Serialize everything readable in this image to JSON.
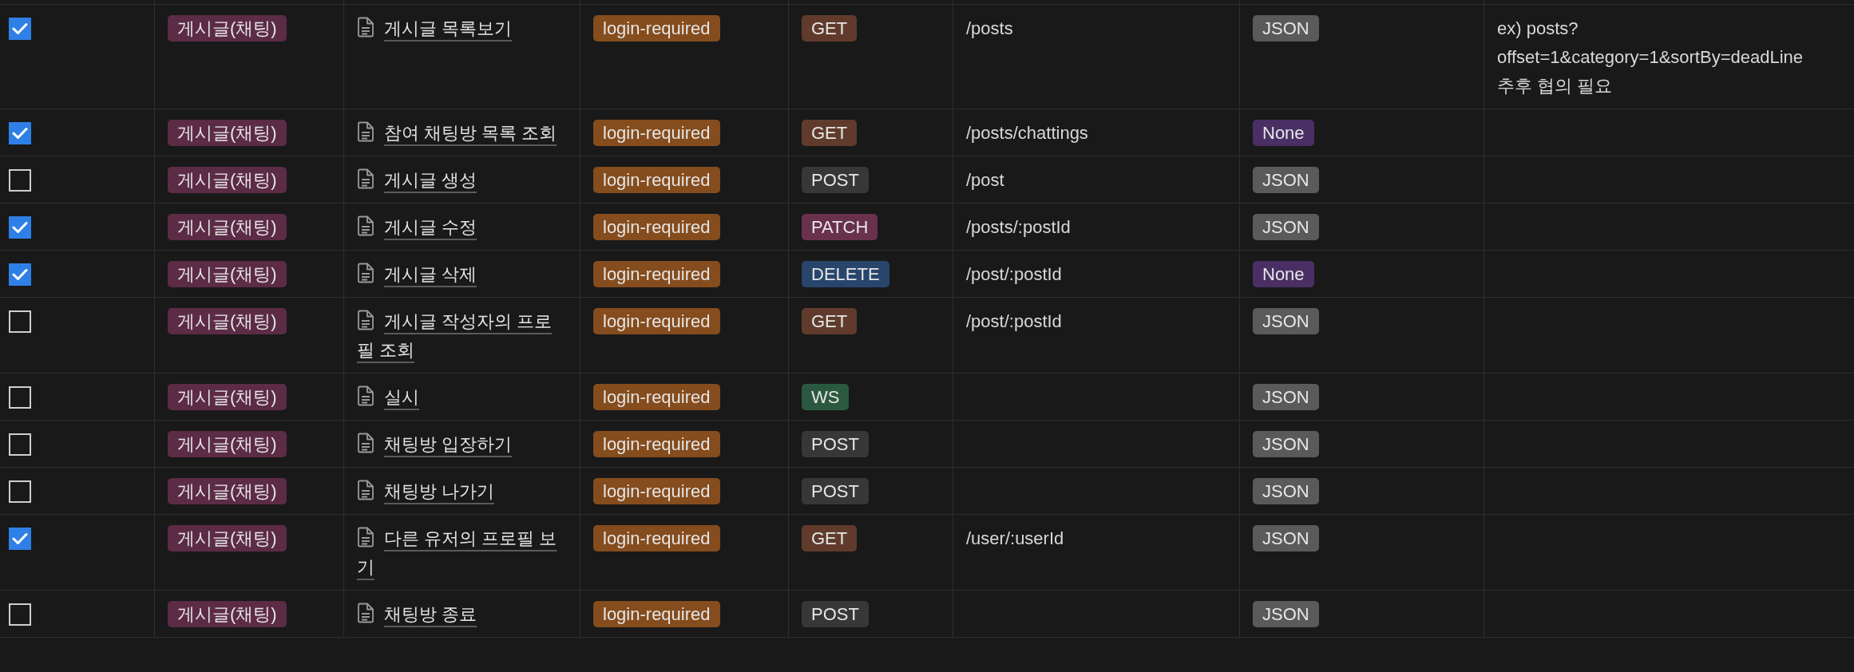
{
  "rows": [
    {
      "checked": true,
      "category": "게시글(채팅)",
      "title": "게시글 목록보기",
      "auth": "login-required",
      "method": {
        "label": "GET",
        "color": "#603b2c"
      },
      "endpoint": "/posts",
      "body": {
        "label": "JSON",
        "color": "#5a5a5a"
      },
      "notes": "ex) posts?offset=1&category=1&sortBy=deadLine\n추후 협의 필요"
    },
    {
      "checked": true,
      "category": "게시글(채팅)",
      "title": "참여 채팅방 목록 조회",
      "auth": "login-required",
      "method": {
        "label": "GET",
        "color": "#603b2c"
      },
      "endpoint": "/posts/chattings",
      "body": {
        "label": "None",
        "color": "#492f64"
      }
    },
    {
      "checked": false,
      "category": "게시글(채팅)",
      "title": "게시글 생성",
      "auth": "login-required",
      "method": {
        "label": "POST",
        "color": "#373737"
      },
      "endpoint": "/post",
      "body": {
        "label": "JSON",
        "color": "#5a5a5a"
      }
    },
    {
      "checked": true,
      "category": "게시글(채팅)",
      "title": "게시글 수정",
      "auth": "login-required",
      "method": {
        "label": "PATCH",
        "color": "#69314c"
      },
      "endpoint": "/posts/:postId",
      "body": {
        "label": "JSON",
        "color": "#5a5a5a"
      }
    },
    {
      "checked": true,
      "category": "게시글(채팅)",
      "title": "게시글 삭제",
      "auth": "login-required",
      "method": {
        "label": "DELETE",
        "color": "#28456c"
      },
      "endpoint": "/post/:postId",
      "body": {
        "label": "None",
        "color": "#492f64"
      }
    },
    {
      "checked": false,
      "category": "게시글(채팅)",
      "title": "게시글 작성자의 프로필 조회",
      "auth": "login-required",
      "method": {
        "label": "GET",
        "color": "#603b2c"
      },
      "endpoint": "/post/:postId",
      "body": {
        "label": "JSON",
        "color": "#5a5a5a"
      }
    },
    {
      "checked": false,
      "category": "게시글(채팅)",
      "title": "실시",
      "auth": "login-required",
      "method": {
        "label": "WS",
        "color": "#2b593f"
      },
      "body": {
        "label": "JSON",
        "color": "#5a5a5a"
      }
    },
    {
      "checked": false,
      "category": "게시글(채팅)",
      "title": "채팅방 입장하기",
      "auth": "login-required",
      "method": {
        "label": "POST",
        "color": "#373737"
      },
      "body": {
        "label": "JSON",
        "color": "#5a5a5a"
      }
    },
    {
      "checked": false,
      "category": "게시글(채팅)",
      "title": "채팅방 나가기",
      "auth": "login-required",
      "method": {
        "label": "POST",
        "color": "#373737"
      },
      "body": {
        "label": "JSON",
        "color": "#5a5a5a"
      }
    },
    {
      "checked": true,
      "category": "게시글(채팅)",
      "title": "다른 유저의 프로필 보기",
      "auth": "login-required",
      "method": {
        "label": "GET",
        "color": "#603b2c"
      },
      "endpoint": "/user/:userId",
      "body": {
        "label": "JSON",
        "color": "#5a5a5a"
      }
    },
    {
      "checked": false,
      "category": "게시글(채팅)",
      "title": "채팅방 종료",
      "auth": "login-required",
      "method": {
        "label": "POST",
        "color": "#373737"
      },
      "body": {
        "label": "JSON",
        "color": "#5a5a5a"
      }
    }
  ]
}
